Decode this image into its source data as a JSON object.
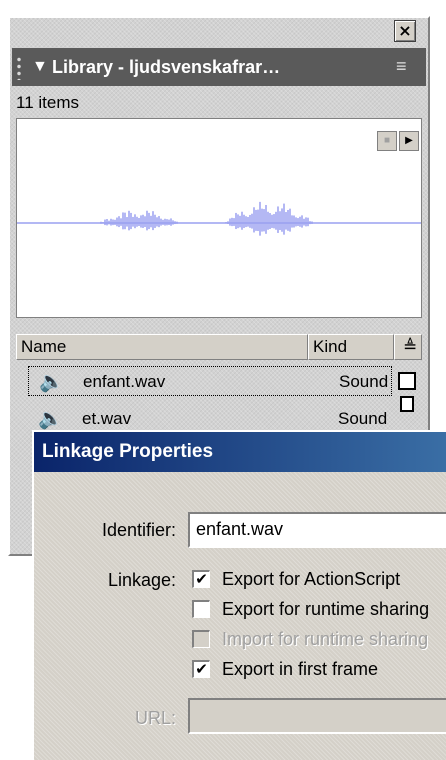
{
  "library": {
    "title": "Library - ljudsvenskafrar…",
    "collapse_arrow": "▼",
    "options_icon": "≡",
    "close_glyph": "×",
    "items_count": "11 items",
    "preview": {
      "stop_glyph": "■",
      "play_glyph": "▶"
    },
    "columns": {
      "name": "Name",
      "kind": "Kind",
      "sort_glyph": "≜"
    },
    "rows": [
      {
        "name": "enfant.wav",
        "kind": "Sound"
      },
      {
        "name": "et.wav",
        "kind": "Sound"
      }
    ]
  },
  "dialog": {
    "title": "Linkage Properties",
    "identifier_label": "Identifier:",
    "identifier_value": "enfant.wav",
    "linkage_label": "Linkage:",
    "options": [
      {
        "label": "Export for ActionScript",
        "checked": true,
        "enabled": true
      },
      {
        "label": "Export for runtime sharing",
        "checked": false,
        "enabled": true
      },
      {
        "label": "Import for runtime sharing",
        "checked": false,
        "enabled": false
      },
      {
        "label": "Export in first frame",
        "checked": true,
        "enabled": true
      }
    ],
    "url_label": "URL:",
    "url_value": ""
  },
  "colors": {
    "panel_header": "#5a5a5a",
    "title_bar_start": "#0a246a",
    "title_bar_end": "#3a6ea5",
    "waveform": "#9aa0f0"
  }
}
